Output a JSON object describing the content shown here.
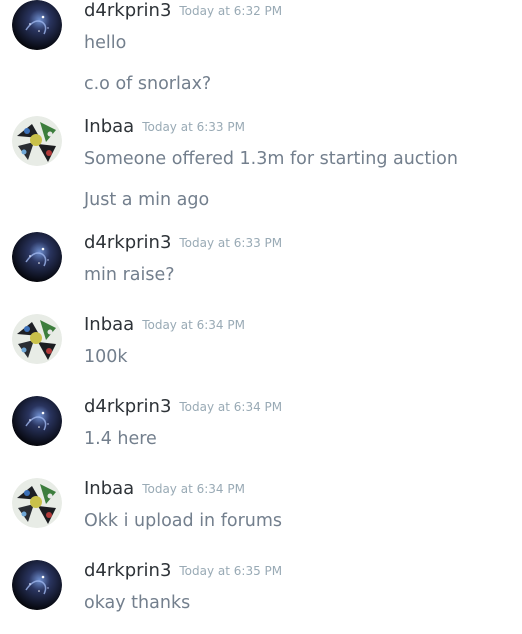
{
  "messages": [
    {
      "author": "d4rkprin3",
      "avatar": "galaxy-avatar",
      "time": "Today at 6:32 PM",
      "lines": [
        "hello",
        "c.o of snorlax?"
      ]
    },
    {
      "author": "Inbaa",
      "avatar": "collage-avatar",
      "time": "Today at 6:33 PM",
      "lines": [
        "Someone offered 1.3m for starting auction",
        "Just a min ago"
      ]
    },
    {
      "author": "d4rkprin3",
      "avatar": "galaxy-avatar",
      "time": "Today at 6:33 PM",
      "lines": [
        "min raise?"
      ]
    },
    {
      "author": "Inbaa",
      "avatar": "collage-avatar",
      "time": "Today at 6:34 PM",
      "lines": [
        "100k"
      ]
    },
    {
      "author": "d4rkprin3",
      "avatar": "galaxy-avatar",
      "time": "Today at 6:34 PM",
      "lines": [
        "1.4 here"
      ]
    },
    {
      "author": "Inbaa",
      "avatar": "collage-avatar",
      "time": "Today at 6:34 PM",
      "lines": [
        "Okk i upload in forums"
      ]
    },
    {
      "author": "d4rkprin3",
      "avatar": "galaxy-avatar",
      "time": "Today at 6:35 PM",
      "lines": [
        "okay thanks"
      ]
    }
  ],
  "colors": {
    "username": "#2e3338",
    "timestamp": "#99aab5",
    "message_text": "#737f8d",
    "background": "#ffffff"
  }
}
